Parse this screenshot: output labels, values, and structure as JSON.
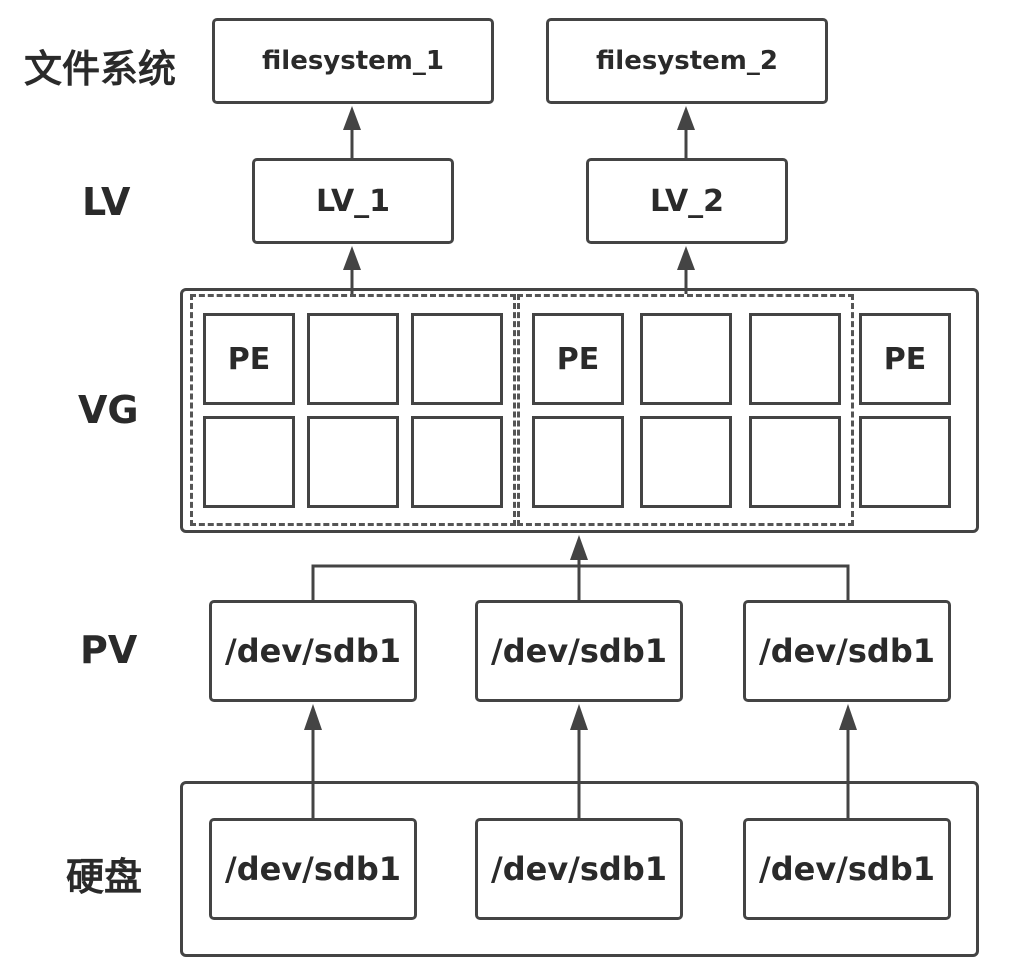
{
  "rows": {
    "filesystem": "文件系统",
    "lv": "LV",
    "vg": "VG",
    "pv": "PV",
    "disk": "硬盘"
  },
  "filesystems": [
    "filesystem_1",
    "filesystem_2"
  ],
  "lvs": [
    "LV_1",
    "LV_2"
  ],
  "pe_label": "PE",
  "pvs": [
    "/dev/sdb1",
    "/dev/sdb1",
    "/dev/sdb1"
  ],
  "disks": [
    "/dev/sdb1",
    "/dev/sdb1",
    "/dev/sdb1"
  ]
}
